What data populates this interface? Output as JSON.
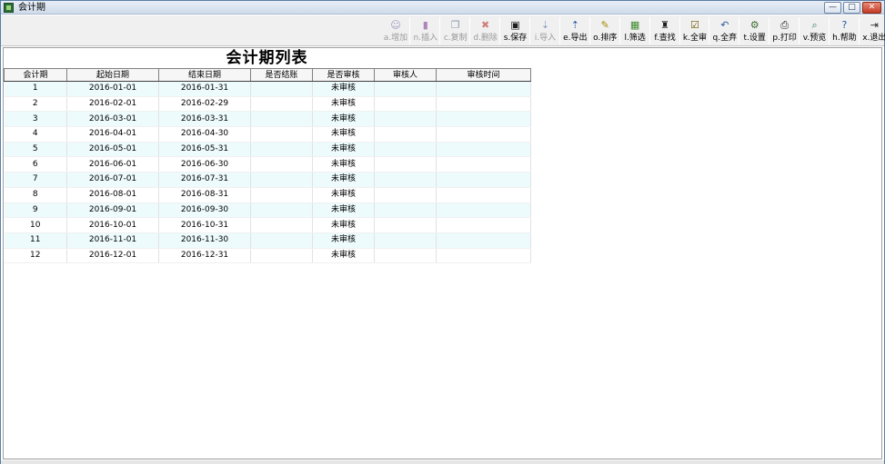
{
  "window": {
    "title": "会计期",
    "controls": {
      "minimize": "—",
      "maximize": "□",
      "close": "✕"
    }
  },
  "toolbar": [
    {
      "key": "add",
      "label": "a.增加",
      "icon": "add-icon",
      "glyph": "☺",
      "color": "#5b4fa0",
      "enabled": false
    },
    {
      "key": "insert",
      "label": "n.插入",
      "icon": "insert-icon",
      "glyph": "▮",
      "color": "#7a2d8c",
      "enabled": false
    },
    {
      "key": "copy",
      "label": "c.复制",
      "icon": "copy-icon",
      "glyph": "❐",
      "color": "#33527a",
      "enabled": false
    },
    {
      "key": "delete",
      "label": "d.删除",
      "icon": "delete-icon",
      "glyph": "✖",
      "color": "#b3261e",
      "enabled": false
    },
    {
      "key": "save",
      "label": "s.保存",
      "icon": "save-icon",
      "glyph": "▣",
      "color": "#1e1e1e",
      "enabled": true
    },
    {
      "key": "import",
      "label": "i.导入",
      "icon": "import-icon",
      "glyph": "⇣",
      "color": "#2f5a9e",
      "enabled": false
    },
    {
      "key": "export",
      "label": "e.导出",
      "icon": "export-icon",
      "glyph": "⇡",
      "color": "#2f5a9e",
      "enabled": true
    },
    {
      "key": "sort",
      "label": "o.排序",
      "icon": "sort-icon",
      "glyph": "✎",
      "color": "#a08a00",
      "enabled": true
    },
    {
      "key": "filter",
      "label": "l.筛选",
      "icon": "filter-icon",
      "glyph": "▦",
      "color": "#3b8a2c",
      "enabled": true
    },
    {
      "key": "find",
      "label": "f.查找",
      "icon": "binoculars-icon",
      "glyph": "♜",
      "color": "#1e1e1e",
      "enabled": true
    },
    {
      "key": "approve_all",
      "label": "k.全审",
      "icon": "approve-all-icon",
      "glyph": "☑",
      "color": "#6a5a00",
      "enabled": true
    },
    {
      "key": "discard_all",
      "label": "q.全弃",
      "icon": "discard-all-icon",
      "glyph": "↶",
      "color": "#2f5a9e",
      "enabled": true
    },
    {
      "key": "settings",
      "label": "t.设置",
      "icon": "settings-icon",
      "glyph": "⚙",
      "color": "#3b6a2c",
      "enabled": true
    },
    {
      "key": "print",
      "label": "p.打印",
      "icon": "print-icon",
      "glyph": "⎙",
      "color": "#1e1e1e",
      "enabled": true
    },
    {
      "key": "preview",
      "label": "v.预览",
      "icon": "preview-icon",
      "glyph": "⌕",
      "color": "#2f7a5e",
      "enabled": true
    },
    {
      "key": "help",
      "label": "h.帮助",
      "icon": "help-icon",
      "glyph": "?",
      "color": "#1e5a9e",
      "enabled": true
    },
    {
      "key": "exit",
      "label": "x.退出",
      "icon": "exit-icon",
      "glyph": "⇥",
      "color": "#2b2b2b",
      "enabled": true
    }
  ],
  "list": {
    "title": "会计期列表",
    "columns": [
      "会计期",
      "起始日期",
      "结束日期",
      "是否结账",
      "是否审核",
      "审核人",
      "审核时间"
    ],
    "rows": [
      [
        "1",
        "2016-01-01",
        "2016-01-31",
        "",
        "未审核",
        "",
        ""
      ],
      [
        "2",
        "2016-02-01",
        "2016-02-29",
        "",
        "未审核",
        "",
        ""
      ],
      [
        "3",
        "2016-03-01",
        "2016-03-31",
        "",
        "未审核",
        "",
        ""
      ],
      [
        "4",
        "2016-04-01",
        "2016-04-30",
        "",
        "未审核",
        "",
        ""
      ],
      [
        "5",
        "2016-05-01",
        "2016-05-31",
        "",
        "未审核",
        "",
        ""
      ],
      [
        "6",
        "2016-06-01",
        "2016-06-30",
        "",
        "未审核",
        "",
        ""
      ],
      [
        "7",
        "2016-07-01",
        "2016-07-31",
        "",
        "未审核",
        "",
        ""
      ],
      [
        "8",
        "2016-08-01",
        "2016-08-31",
        "",
        "未审核",
        "",
        ""
      ],
      [
        "9",
        "2016-09-01",
        "2016-09-30",
        "",
        "未审核",
        "",
        ""
      ],
      [
        "10",
        "2016-10-01",
        "2016-10-31",
        "",
        "未审核",
        "",
        ""
      ],
      [
        "11",
        "2016-11-01",
        "2016-11-30",
        "",
        "未审核",
        "",
        ""
      ],
      [
        "12",
        "2016-12-01",
        "2016-12-31",
        "",
        "未审核",
        "",
        ""
      ]
    ]
  },
  "colors": {
    "alt_row": "#edfbfd",
    "disabled_text": "#9a9a9a"
  }
}
